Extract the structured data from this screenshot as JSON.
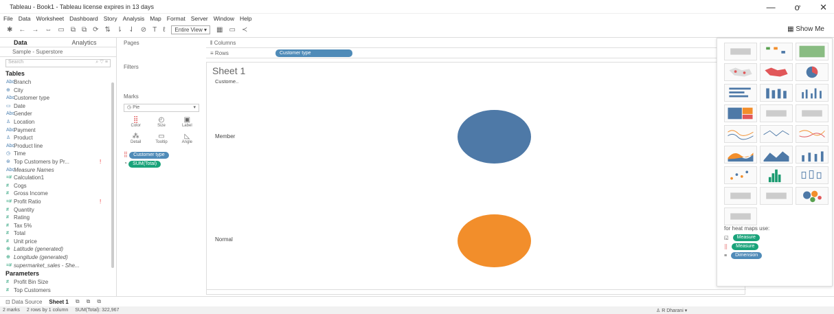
{
  "window": {
    "title": "Tableau - Book1 - Tableau license expires in 13 days",
    "min": "—",
    "max": "ơ",
    "close": "✕"
  },
  "menu": [
    "File",
    "Data",
    "Worksheet",
    "Dashboard",
    "Story",
    "Analysis",
    "Map",
    "Format",
    "Server",
    "Window",
    "Help"
  ],
  "toolbar": {
    "view": "Entire View",
    "show_me": "Show Me"
  },
  "left": {
    "tab_data": "Data",
    "tab_analytics": "Analytics",
    "datasource": "Sample - Superstore",
    "search": "Search",
    "tables_header": "Tables",
    "fields": [
      {
        "name": "Branch",
        "kind": "dim",
        "icon": "Abc"
      },
      {
        "name": "City",
        "kind": "dim",
        "icon": "⊕"
      },
      {
        "name": "Customer type",
        "kind": "dim",
        "icon": "Abc"
      },
      {
        "name": "Date",
        "kind": "dim",
        "icon": "▭"
      },
      {
        "name": "Gender",
        "kind": "dim",
        "icon": "Abc"
      },
      {
        "name": "Location",
        "kind": "dim",
        "icon": "♙"
      },
      {
        "name": "Payment",
        "kind": "dim",
        "icon": "Abc"
      },
      {
        "name": "Product",
        "kind": "dim",
        "icon": "♙"
      },
      {
        "name": "Product line",
        "kind": "dim",
        "icon": "Abc"
      },
      {
        "name": "Time",
        "kind": "dim",
        "icon": "◷"
      },
      {
        "name": "Top Customers by Pr...",
        "kind": "dim",
        "icon": "⊛",
        "warn": "!"
      },
      {
        "name": "Measure Names",
        "kind": "dim",
        "icon": "Abc",
        "italic": true
      },
      {
        "name": "Calculation1",
        "kind": "mea",
        "icon": "=#"
      },
      {
        "name": "Cogs",
        "kind": "mea",
        "icon": "#"
      },
      {
        "name": "Gross Income",
        "kind": "mea",
        "icon": "#"
      },
      {
        "name": "Profit Ratio",
        "kind": "mea",
        "icon": "=#",
        "warn": "!"
      },
      {
        "name": "Quantity",
        "kind": "mea",
        "icon": "#"
      },
      {
        "name": "Rating",
        "kind": "mea",
        "icon": "#"
      },
      {
        "name": "Tax 5%",
        "kind": "mea",
        "icon": "#"
      },
      {
        "name": "Total",
        "kind": "mea",
        "icon": "#"
      },
      {
        "name": "Unit price",
        "kind": "mea",
        "icon": "#"
      },
      {
        "name": "Latitude (generated)",
        "kind": "mea",
        "icon": "⊕",
        "italic": true
      },
      {
        "name": "Longitude (generated)",
        "kind": "mea",
        "icon": "⊕",
        "italic": true
      },
      {
        "name": "supermarket_sales - She...",
        "kind": "mea",
        "icon": "=#",
        "italic": true
      }
    ],
    "params_header": "Parameters",
    "params": [
      {
        "name": "Profit Bin Size",
        "icon": "#"
      },
      {
        "name": "Top Customers",
        "icon": "#"
      }
    ]
  },
  "cards": {
    "pages": "Pages",
    "filters": "Filters",
    "marks": "Marks",
    "mark_type": "Pie",
    "mark_buttons": [
      "Color",
      "Size",
      "Label",
      "Detail",
      "Tooltip",
      "Angle"
    ],
    "mark_pills": [
      "Customer type",
      "SUM(Total)"
    ]
  },
  "shelves": {
    "columns": "Columns",
    "rows": "Rows",
    "rows_pill": "Customer type"
  },
  "sheet": {
    "title": "Sheet 1",
    "col_header": "Custome..",
    "rows": [
      {
        "label": "Member",
        "color": "#4e79a7"
      },
      {
        "label": "Normal",
        "color": "#f28e2b"
      }
    ]
  },
  "showme": {
    "hint": "for heat maps use:",
    "legend": [
      "Measure",
      "Measure",
      "Dimension"
    ]
  },
  "bottom": {
    "datasource": "Data Source",
    "sheet": "Sheet 1"
  },
  "status": {
    "marks": "2 marks",
    "rows": "2 rows by 1 column",
    "sum": "SUM(Total): 322,967",
    "user": "R Dharani"
  }
}
